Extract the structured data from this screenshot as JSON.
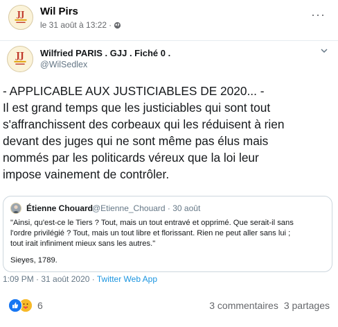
{
  "post": {
    "author": "Wil Pirs",
    "date": "le 31 août à 13:22",
    "audience_icon": "globe-icon",
    "more_label": "···"
  },
  "tweet": {
    "name": "Wilfried PARIS . GJJ . Fiché 0 .",
    "handle": "@WilSedlex",
    "text_lines": [
      "- APPLICABLE AUX JUSTICIABLES DE 2020... -",
      "Il est grand temps que les justiciables qui sont tout",
      "s'affranchissent des corbeaux qui les réduisent à rien",
      "devant des juges qui ne sont même pas élus mais",
      "nommés par les politicards véreux que la loi leur",
      "impose vainement de contrôler."
    ],
    "quote": {
      "name": "Étienne Chouard",
      "handle": "@Etienne_Chouard · 30 août",
      "lines": [
        "\"Ainsi, qu'est-ce le Tiers ? Tout, mais un tout entravé et opprimé. Que serait-il sans",
        "l'ordre privilégié ? Tout, mais un tout libre et florissant. Rien ne peut aller sans lui ;",
        "tout irait infiniment mieux sans les autres.\""
      ],
      "signature": "Sieyes, 1789."
    },
    "footer_time": "1:09 PM · 31 août 2020 · ",
    "footer_via": "Twitter Web App"
  },
  "reactions": {
    "icons": [
      "like-icon",
      "care-icon"
    ],
    "count": "6",
    "comments": "3 commentaires",
    "shares": "3 partages"
  },
  "colors": {
    "link": "#1b95e0",
    "like": "#1877f2",
    "care": "#f7b928"
  }
}
